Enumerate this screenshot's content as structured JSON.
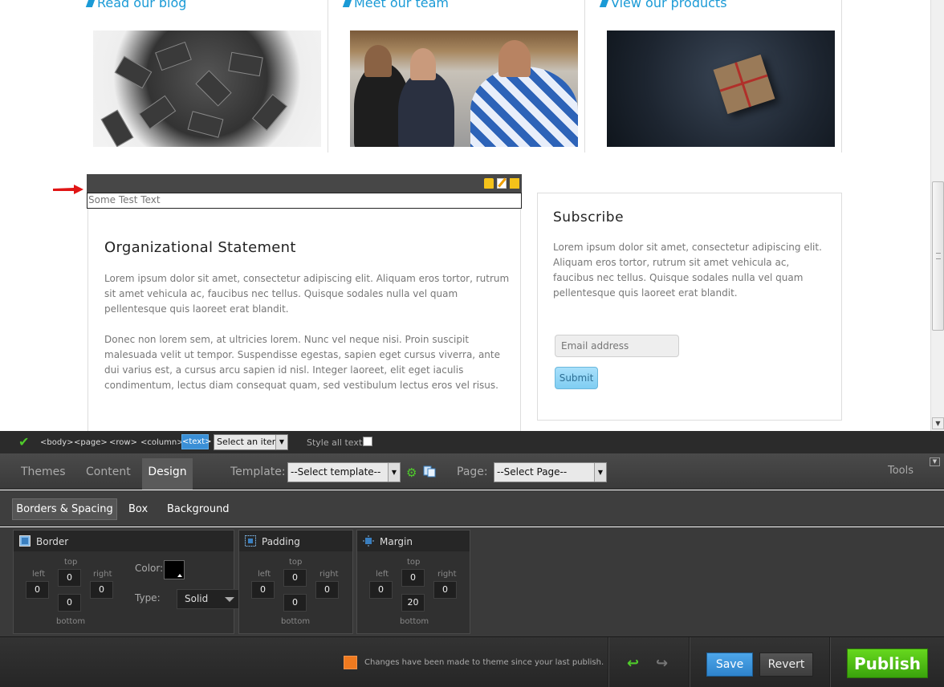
{
  "site": {
    "features": [
      {
        "heading": "Read our blog"
      },
      {
        "heading": "Meet our team"
      },
      {
        "heading": "View our products"
      }
    ],
    "selected_text": "Some Test Text",
    "org": {
      "title": "Organizational Statement",
      "para1": "Lorem ipsum dolor sit amet, consectetur adipiscing elit. Aliquam eros tortor, rutrum sit amet vehicula ac, faucibus nec tellus. Quisque sodales nulla vel quam pellentesque quis laoreet erat blandit.",
      "para2": "Donec non lorem sem, at ultricies lorem. Nunc vel neque nisi. Proin suscipit malesuada velit ut tempor. Suspendisse egestas, sapien eget cursus viverra, ante dui varius est, a cursus arcu sapien id nisl. Integer laoreet, elit eget iaculis condimentum, lectus diam consequat quam, sed vestibulum lectus eros vel risus."
    },
    "subscribe": {
      "title": "Subscribe",
      "text": "Lorem ipsum dolor sit amet, consectetur adipiscing elit. Aliquam eros tortor, rutrum sit amet vehicula ac, faucibus nec tellus. Quisque sodales nulla vel quam pellentesque quis laoreet erat blandit.",
      "email_placeholder": "Email address",
      "submit_label": "Submit"
    }
  },
  "editor": {
    "breadcrumbs": [
      "<body>",
      "<page>",
      "<row>",
      "<column>",
      "<text>"
    ],
    "select_item": "Select an item",
    "style_all_label": "Style all texts",
    "tabs": {
      "themes": "Themes",
      "content": "Content",
      "design": "Design"
    },
    "template_label": "Template:",
    "template_value": "--Select template--",
    "page_label": "Page:",
    "page_value": "--Select Page--",
    "tools_label": "Tools",
    "subtabs": {
      "borders": "Borders & Spacing",
      "box": "Box",
      "background": "Background"
    },
    "panels": {
      "border": {
        "title": "Border",
        "top": "0",
        "left": "0",
        "right": "0",
        "bottom": "0",
        "color_label": "Color:",
        "color": "#000000",
        "type_label": "Type:",
        "type": "Solid"
      },
      "padding": {
        "title": "Padding",
        "top": "0",
        "left": "0",
        "right": "0",
        "bottom": "0"
      },
      "margin": {
        "title": "Margin",
        "top": "0",
        "left": "0",
        "right": "0",
        "bottom": "20"
      }
    },
    "side_labels": {
      "top": "top",
      "left": "left",
      "right": "right",
      "bottom": "bottom"
    },
    "notice": "Changes have been made to theme since your last publish.",
    "save": "Save",
    "revert": "Revert",
    "publish": "Publish"
  },
  "colors": {
    "accent_blue": "#1a9ad6",
    "publish_green": "#4cbf14",
    "save_blue": "#3a91d8",
    "notice_orange": "#f07a1f"
  }
}
